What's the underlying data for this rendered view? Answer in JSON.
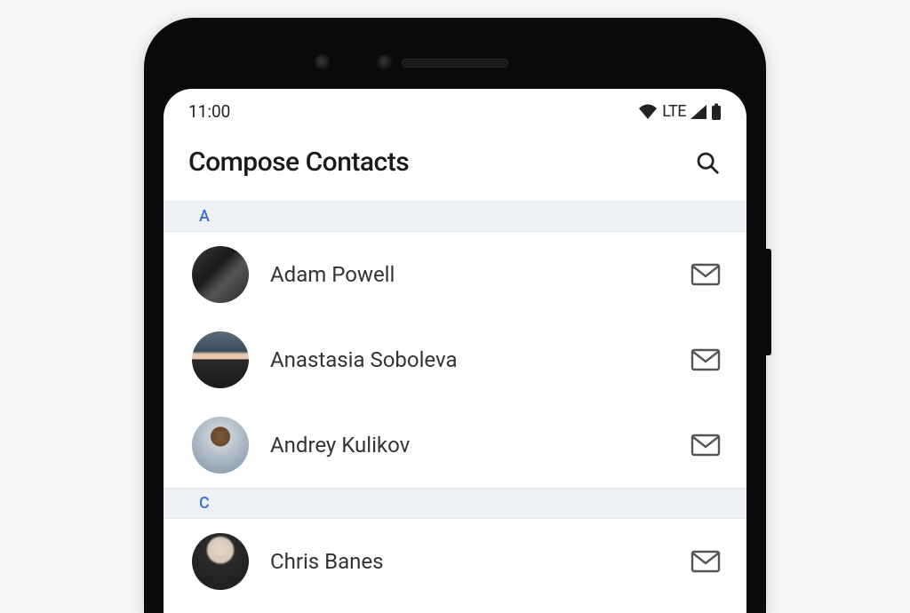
{
  "statusBar": {
    "time": "11:00",
    "networkLabel": "LTE"
  },
  "appBar": {
    "title": "Compose Contacts"
  },
  "sections": [
    {
      "letter": "A",
      "contacts": [
        {
          "name": "Adam Powell",
          "avatarClass": "avatar1"
        },
        {
          "name": "Anastasia Soboleva",
          "avatarClass": "avatar2"
        },
        {
          "name": "Andrey Kulikov",
          "avatarClass": "avatar3"
        }
      ]
    },
    {
      "letter": "C",
      "contacts": [
        {
          "name": "Chris Banes",
          "avatarClass": "avatar4"
        }
      ]
    }
  ]
}
